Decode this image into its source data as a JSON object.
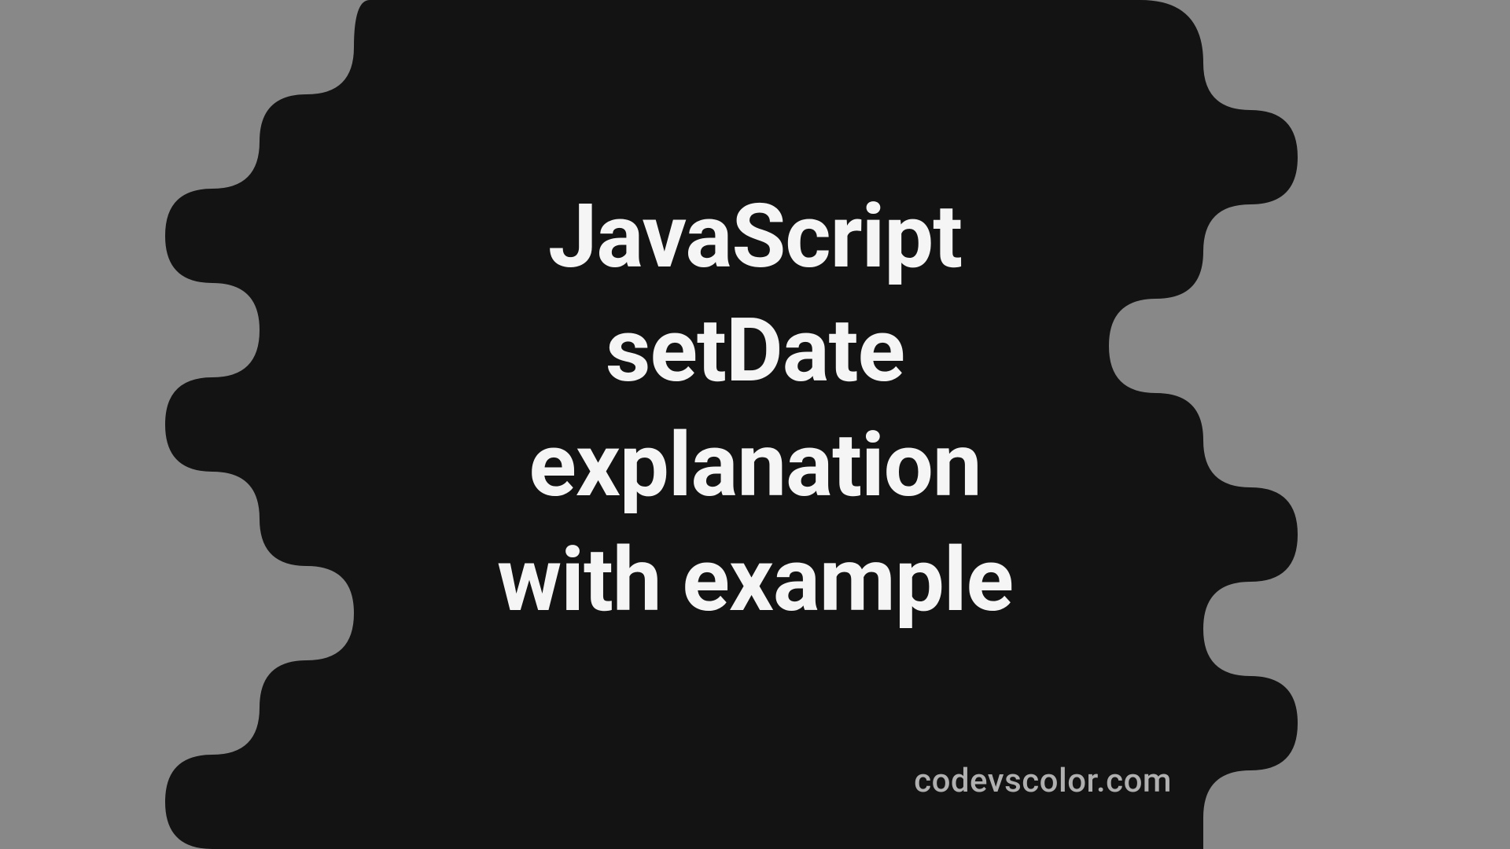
{
  "title_lines": [
    "JavaScript",
    "setDate",
    "explanation",
    "with example"
  ],
  "site_url": "codevscolor.com",
  "colors": {
    "background": "#888888",
    "blob": "#131313",
    "title": "#f5f5f5",
    "url": "#b0b0b0"
  }
}
